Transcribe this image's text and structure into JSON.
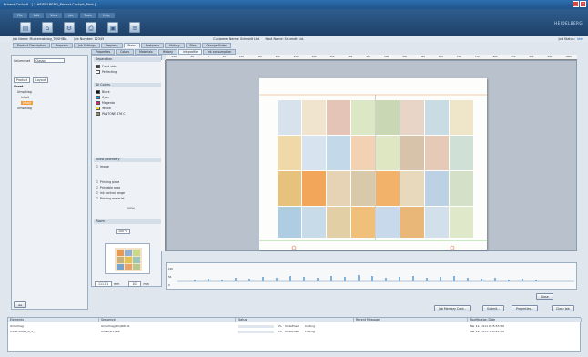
{
  "window": {
    "title": "Prinect Cockpit - [ 3-HEIDELBERG_Prinect Cockpit_Print ]",
    "menu": [
      "File",
      "Edit",
      "View",
      "Job",
      "Tools",
      "Help"
    ]
  },
  "brand": "HEIDELBERG",
  "jobbar": {
    "job_name": "Job Name: Mustercatalog_TOSHIBA",
    "job_number": "Job Number: 12345",
    "customer_name": "Customer Name: Schmidt Ltd.",
    "next_name": "Next Name: Schmidt Ltd.",
    "job_status": "Job Status:",
    "job_status_value": "Idle"
  },
  "tabs_primary": [
    "Product Description",
    "Prepress",
    "Job Settings",
    "Prepress",
    "Press",
    "Postpress",
    "History",
    "Files",
    "Change Order"
  ],
  "tabs_secondary": [
    "Properties",
    "Colors",
    "Materials",
    "History",
    "Ink profile",
    "Ink consumption"
  ],
  "left_panel": {
    "column_set_label": "Column set",
    "column_set_value": "Classic",
    "filter_items": [
      "Product",
      "Layout"
    ],
    "tree": [
      "Sheet",
      "Umschlag",
      "Inhalt",
      "Inhalt",
      "Umschlag"
    ]
  },
  "middle_panel": {
    "separation_header": "Separation",
    "separations": [
      "Front side",
      "Perfecting"
    ],
    "colors_header": "All Colors",
    "colors": [
      {
        "name": "Black",
        "hex": "#111111"
      },
      {
        "name": "Cyan",
        "hex": "#00a6e0"
      },
      {
        "name": "Magenta",
        "hex": "#e0207a"
      },
      {
        "name": "Yellow",
        "hex": "#f5e11a"
      },
      {
        "name": "PANTONE 876 C",
        "hex": "#9a8a6a"
      }
    ],
    "geometry_header": "Show geometry",
    "geometry": [
      "Image",
      "Printing plate",
      "Printable area",
      "Ink control range",
      "Printing material"
    ],
    "zoom_value": "100%",
    "zoom_header": "Zoom",
    "zoom_percent": "100 %"
  },
  "canvas": {
    "ruler_h_labels": [
      "-100",
      "-50",
      "0",
      "50",
      "100",
      "150",
      "200",
      "250",
      "300",
      "350",
      "400",
      "450",
      "500",
      "550",
      "600",
      "650",
      "700",
      "750",
      "800",
      "850",
      "900",
      "950",
      "1000"
    ],
    "coord_x_value": "1111.1",
    "coord_unit": "mm",
    "coord_y_value": "102"
  },
  "ink_strip": {
    "scale": [
      "100",
      "50",
      "0"
    ]
  },
  "buttons": {
    "close": "Close",
    "job_memory_card": "Job Memory Card...",
    "submit": "Submit...",
    "properties": "Properties...",
    "close_job": "Close Job"
  },
  "bottom_table": {
    "headers": [
      "Elements",
      "Sequence",
      "Status",
      "Recent Message",
      "Modification Date"
    ],
    "rows": [
      {
        "element": "Umschlag",
        "sequence": "Umschlag(Pr1)RIP-01",
        "status_pct": "0%",
        "status_text": "Undefined",
        "status_step": "Cutting",
        "message": "",
        "date": "Mar 11, 2011 9:25:53 PM"
      },
      {
        "element": "Inhalt Inhalt_B_1_1",
        "sequence": "Inhalt(Pr1)RIP",
        "status_pct": "0%",
        "status_text": "Undefined",
        "status_step": "Folding",
        "message": "",
        "date": "Mar 11, 2011 3:45:22 PM"
      }
    ]
  },
  "accent": {
    "selection": "#f39c3d",
    "titlebar": "#2d6fb0"
  }
}
